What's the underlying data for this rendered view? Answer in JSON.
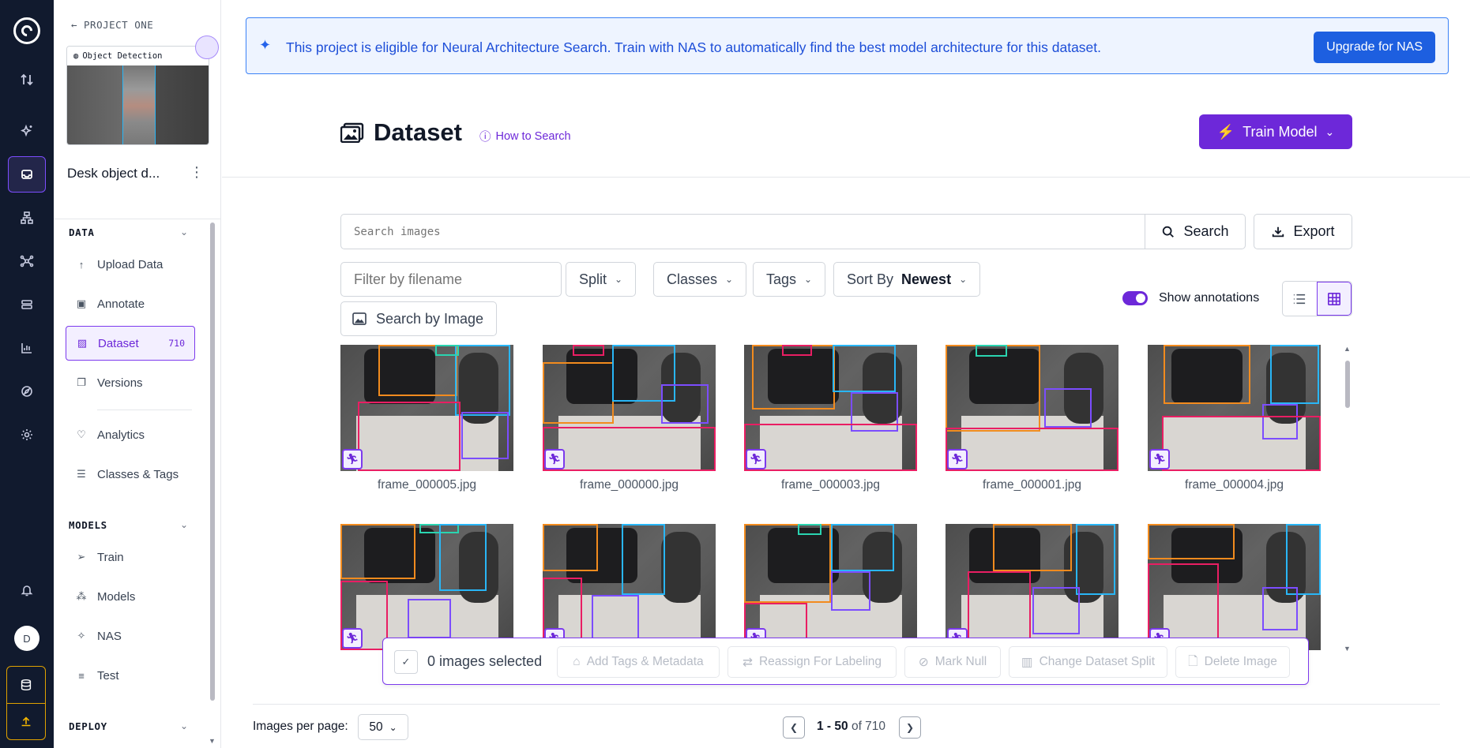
{
  "colors": {
    "accent": "#6d28d9",
    "rail_bg": "#111a2e",
    "banner_blue": "#1d5fe0",
    "box_orange": "#f28b1e",
    "box_cyan": "#29b6f6",
    "box_pink": "#e91e63",
    "box_purple": "#7c4dff",
    "box_teal": "#2ad4b0"
  },
  "rail": {
    "icons": [
      "logo-icon",
      "swap-icon",
      "sparkle-icon",
      "inbox-icon",
      "workflow-icon",
      "graph-icon",
      "stack-icon",
      "chart-icon",
      "compass-icon",
      "gear-icon",
      "bell-icon",
      "database-icon",
      "upload-icon"
    ],
    "avatar_initial": "D"
  },
  "sidebar": {
    "back_label": "PROJECT ONE",
    "project_type": "Object Detection",
    "project_name": "Desk object d...",
    "sections": {
      "data": "DATA",
      "models": "MODELS",
      "deploy": "DEPLOY"
    },
    "data_items": [
      {
        "label": "Upload Data",
        "icon": "upload-arrow-icon"
      },
      {
        "label": "Annotate",
        "icon": "annotate-icon"
      },
      {
        "label": "Dataset",
        "icon": "image-icon",
        "count": "710",
        "active": true
      },
      {
        "label": "Versions",
        "icon": "versions-icon"
      },
      {
        "label": "Analytics",
        "icon": "heart-pulse-icon"
      },
      {
        "label": "Classes & Tags",
        "icon": "list-icon"
      }
    ],
    "model_items": [
      {
        "label": "Train",
        "icon": "send-icon"
      },
      {
        "label": "Models",
        "icon": "nodes-icon"
      },
      {
        "label": "NAS",
        "icon": "wand-icon"
      },
      {
        "label": "Test",
        "icon": "bar-list-icon"
      }
    ]
  },
  "banner": {
    "text": "This project is eligible for Neural Architecture Search. Train with NAS to automatically find the best model architecture for this dataset.",
    "button": "Upgrade for NAS"
  },
  "header": {
    "title": "Dataset",
    "how_to": "How to Search",
    "train_button": "Train Model"
  },
  "toolbar": {
    "search_placeholder": "Search images",
    "search_button": "Search",
    "export_button": "Export",
    "filter_placeholder": "Filter by filename",
    "split": "Split",
    "classes": "Classes",
    "tags": "Tags",
    "sort_label": "Sort By",
    "sort_value": "Newest",
    "search_by_image": "Search by Image",
    "show_annotations": "Show annotations",
    "show_annotations_on": true
  },
  "images": [
    {
      "name": "frame_000005.jpg"
    },
    {
      "name": "frame_000000.jpg"
    },
    {
      "name": "frame_000003.jpg"
    },
    {
      "name": "frame_000001.jpg"
    },
    {
      "name": "frame_000004.jpg"
    },
    {
      "name": ""
    },
    {
      "name": ""
    },
    {
      "name": ""
    },
    {
      "name": ""
    },
    {
      "name": ""
    }
  ],
  "selection": {
    "count_text": "0 images selected",
    "actions": [
      "Add Tags & Metadata",
      "Reassign For Labeling",
      "Mark Null",
      "Change Dataset Split",
      "Delete Image"
    ]
  },
  "pagination": {
    "per_page_label": "Images per page:",
    "per_page": "50",
    "range": "1 - 50",
    "of": "of 710"
  }
}
